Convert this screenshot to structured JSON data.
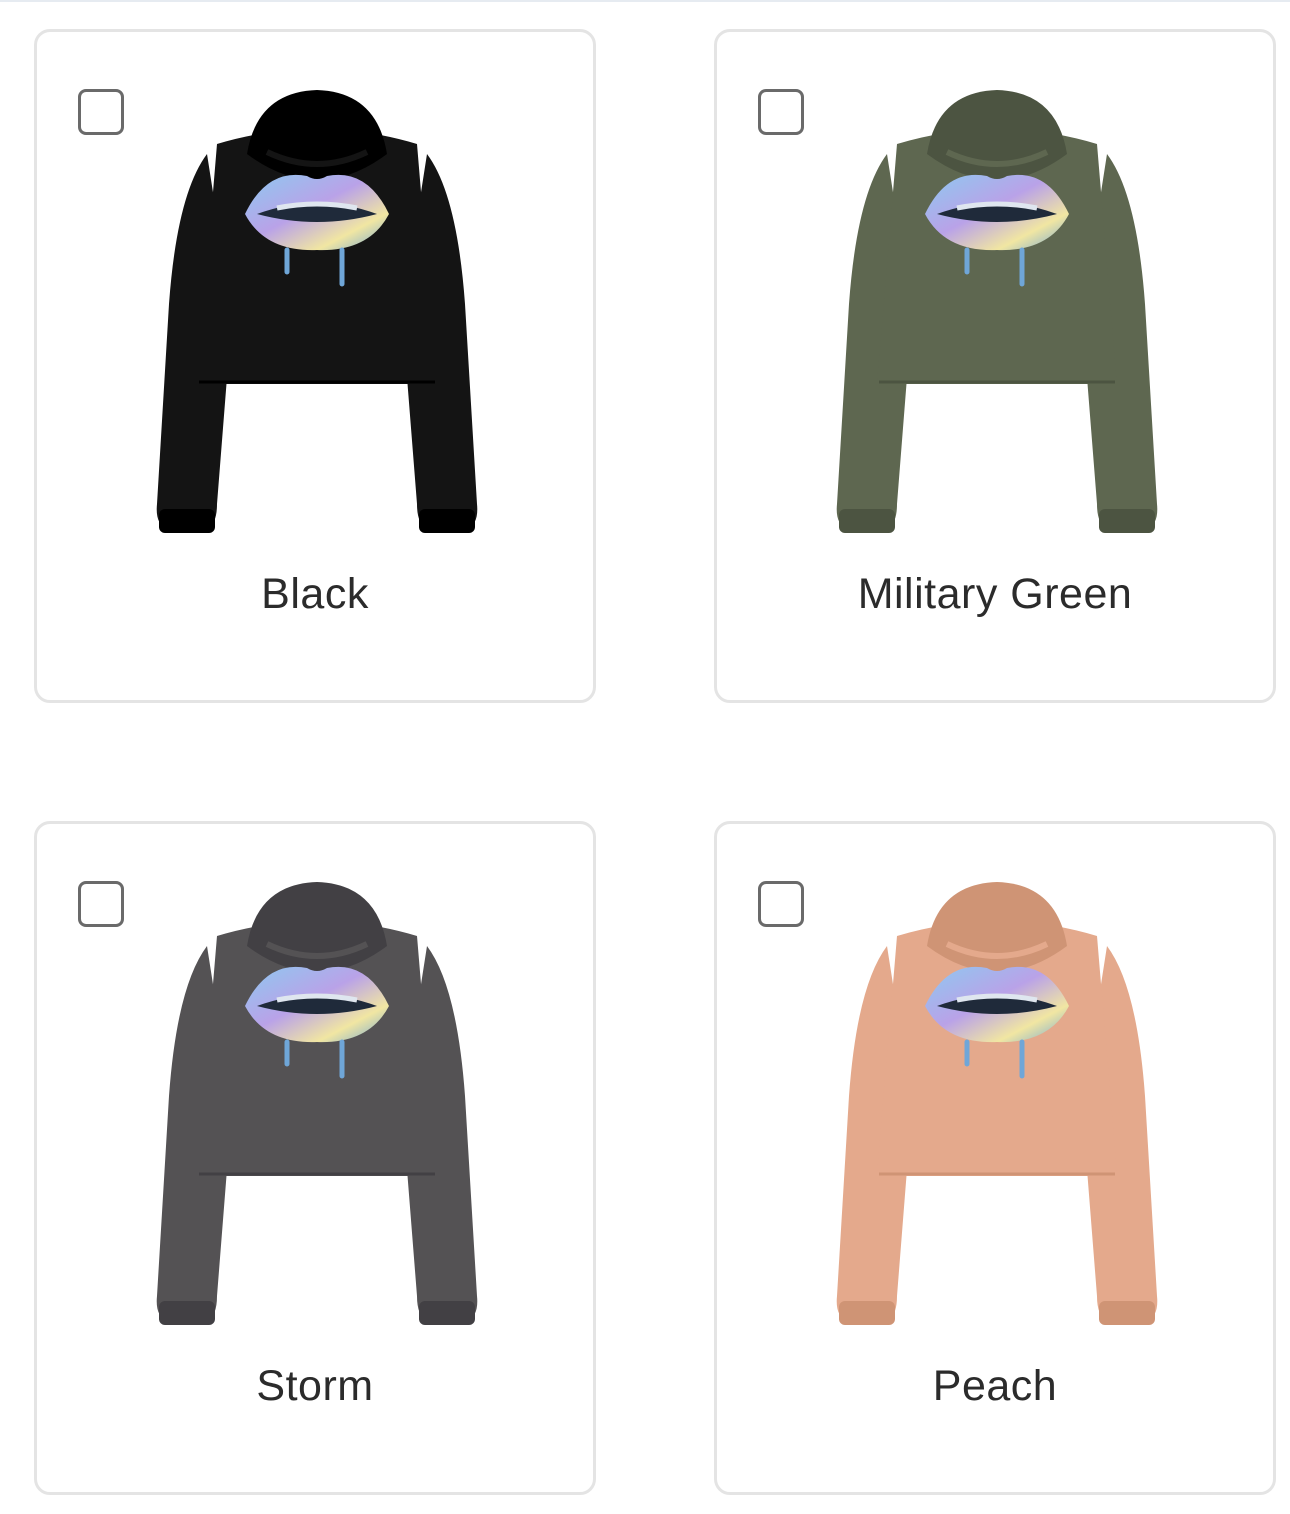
{
  "variants": [
    {
      "label": "Black",
      "color": "#141414",
      "shade": "#000000",
      "selected": false
    },
    {
      "label": "Military Green",
      "color": "#5e6750",
      "shade": "#4c5441",
      "selected": false
    },
    {
      "label": "Storm",
      "color": "#545254",
      "shade": "#424044",
      "selected": false
    },
    {
      "label": "Peach",
      "color": "#e4a98c",
      "shade": "#cf9475",
      "selected": false
    }
  ],
  "print_colors": [
    "#8ec9f0",
    "#b9a2e8",
    "#f1e6a2",
    "#6fa6d8"
  ],
  "icons": {
    "checkbox": "checkbox-icon",
    "product": "cropped-hoodie-image"
  }
}
